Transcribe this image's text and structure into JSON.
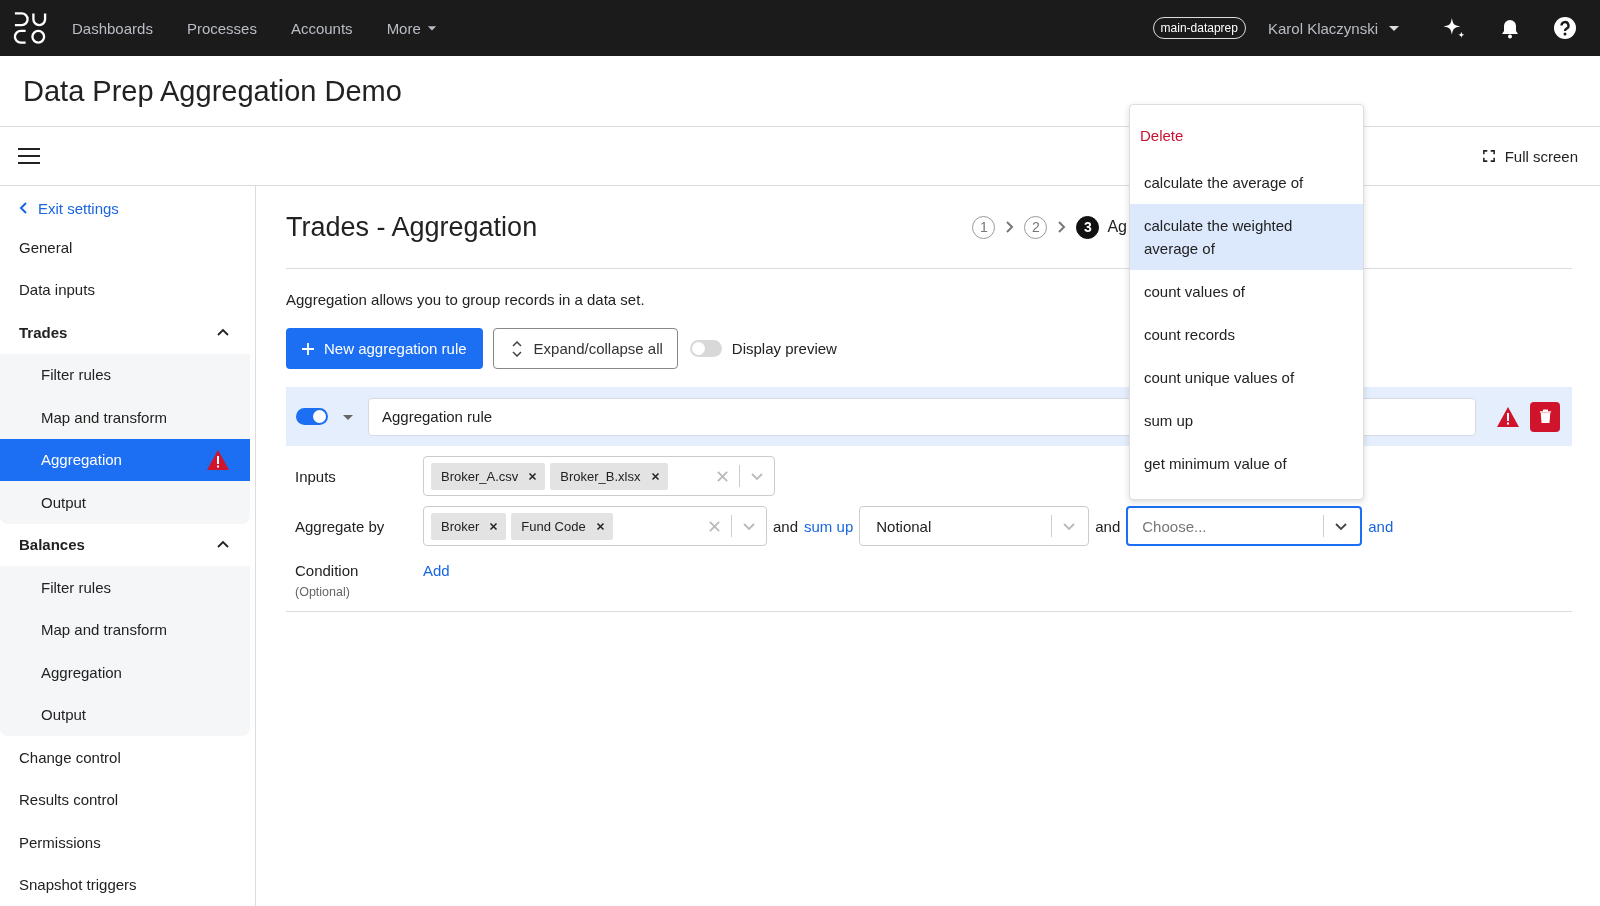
{
  "top_nav": {
    "items": [
      {
        "label": "Dashboards"
      },
      {
        "label": "Processes"
      },
      {
        "label": "Accounts"
      },
      {
        "label": "More",
        "kind": "dropdown"
      }
    ],
    "branch": "main-dataprep",
    "user": "Karol Klaczynski"
  },
  "page_title": "Data Prep Aggregation Demo",
  "toolbar": {
    "full_screen": "Full screen"
  },
  "sidebar": {
    "back": "Exit settings",
    "items": [
      {
        "label": "General",
        "kind": "link",
        "selected": false
      },
      {
        "label": "Data inputs",
        "kind": "link",
        "selected": false
      },
      {
        "label": "Trades",
        "kind": "group",
        "expanded": true,
        "children": [
          {
            "label": "Filter rules",
            "selected": false,
            "warning": false
          },
          {
            "label": "Map and transform",
            "selected": false,
            "warning": false
          },
          {
            "label": "Aggregation",
            "selected": true,
            "warning": true
          },
          {
            "label": "Output",
            "selected": false,
            "warning": false
          }
        ]
      },
      {
        "label": "Balances",
        "kind": "group",
        "expanded": true,
        "children": [
          {
            "label": "Filter rules",
            "selected": false,
            "warning": false
          },
          {
            "label": "Map and transform",
            "selected": false,
            "warning": false
          },
          {
            "label": "Aggregation",
            "selected": false,
            "warning": false
          },
          {
            "label": "Output",
            "selected": false,
            "warning": false
          }
        ]
      },
      {
        "label": "Change control",
        "kind": "link",
        "selected": false
      },
      {
        "label": "Results control",
        "kind": "link",
        "selected": false
      },
      {
        "label": "Permissions",
        "kind": "link",
        "selected": false
      },
      {
        "label": "Snapshot triggers",
        "kind": "link",
        "selected": false
      }
    ]
  },
  "main": {
    "title": "Trades - Aggregation",
    "steps": [
      {
        "number": "1",
        "current": false
      },
      {
        "number": "2",
        "current": false
      },
      {
        "number": "3",
        "current": true,
        "label": "Ag"
      }
    ],
    "description": "Aggregation allows you to group records in a data set.",
    "new_button": "New aggregation rule",
    "expand_button": "Expand/collapse all",
    "preview": {
      "label": "Display preview",
      "on": false
    },
    "rule": {
      "enabled": true,
      "expanded": true,
      "name": "Aggregation rule",
      "warning": true,
      "inputs": {
        "label": "Inputs",
        "tags": [
          "Broker_A.csv",
          "Broker_B.xlsx"
        ]
      },
      "aggregate_by": {
        "label": "Aggregate by",
        "tags": [
          "Broker",
          "Fund Code"
        ],
        "joiner": "and",
        "function": "sum up",
        "field": "Notional",
        "joiner_2": "and",
        "next_field": {
          "placeholder": "Choose...",
          "focused": true
        },
        "add_link": "and"
      },
      "condition": {
        "label": "Condition",
        "hint": "(Optional)",
        "add": "Add"
      }
    }
  },
  "menu": {
    "items": [
      {
        "label": "Delete",
        "kind": "danger",
        "selected": false
      },
      {
        "label": "calculate the average of",
        "kind": "option",
        "selected": false
      },
      {
        "label": "calculate the weighted average of",
        "kind": "option",
        "selected": true
      },
      {
        "label": "count values of",
        "kind": "option",
        "selected": false
      },
      {
        "label": "count records",
        "kind": "option",
        "selected": false
      },
      {
        "label": "count unique values of",
        "kind": "option",
        "selected": false
      },
      {
        "label": "sum up",
        "kind": "option",
        "selected": false
      },
      {
        "label": "get minimum value of",
        "kind": "option",
        "selected": false
      }
    ]
  }
}
